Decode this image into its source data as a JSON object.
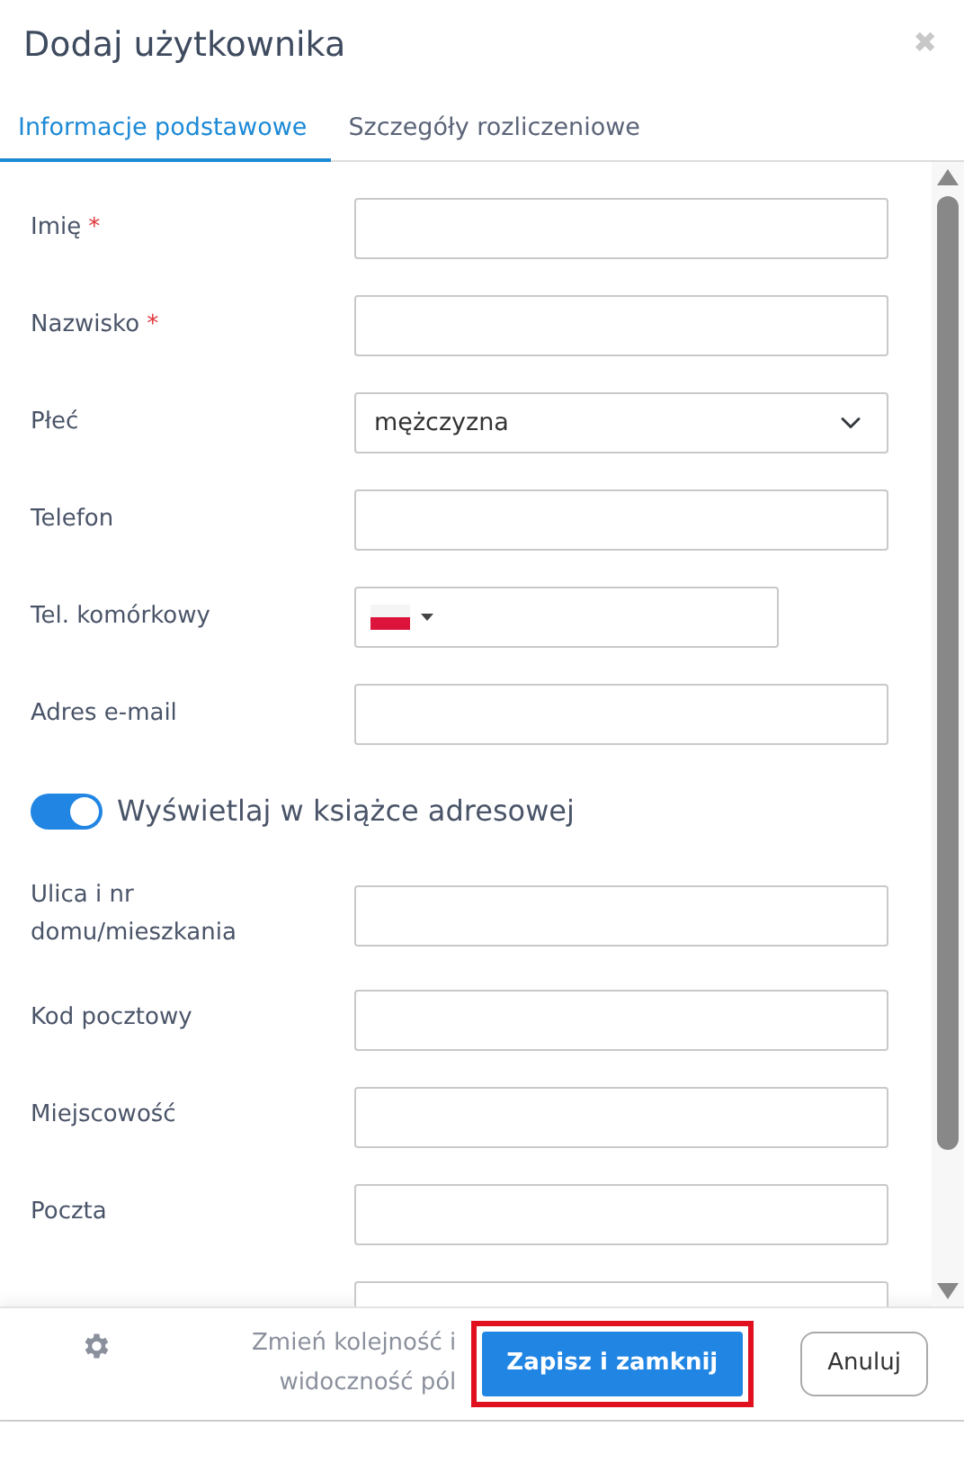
{
  "dialog": {
    "title": "Dodaj użytkownika",
    "close_icon": "✖"
  },
  "tabs": [
    {
      "label": "Informacje podstawowe",
      "selected": true
    },
    {
      "label": "Szczegóły rozliczeniowe",
      "selected": false
    }
  ],
  "fields": [
    {
      "kind": "text",
      "label": "Imię",
      "required_mark": "*"
    },
    {
      "kind": "text",
      "label": "Nazwisko",
      "required_mark": "*"
    },
    {
      "kind": "select",
      "label": "Płeć",
      "value": "mężczyzna"
    },
    {
      "kind": "text",
      "label": "Telefon"
    },
    {
      "kind": "phone",
      "label": "Tel. komórkowy"
    },
    {
      "kind": "text",
      "label": "Adres e-mail"
    },
    {
      "kind": "toggle",
      "label": "Wyświetlaj w książce adresowej",
      "on": true
    },
    {
      "kind": "text",
      "label": "Ulica i nr domu/mieszkania"
    },
    {
      "kind": "text",
      "label": "Kod pocztowy"
    },
    {
      "kind": "text",
      "label": "Miejscowość"
    },
    {
      "kind": "text",
      "label": "Poczta"
    },
    {
      "kind": "text"
    }
  ],
  "footer": {
    "settings_link": "Zmień kolejność i widoczność pól",
    "buttons": [
      {
        "kind": "primary",
        "label": "Zapisz i zamknij",
        "highlighted": true
      },
      {
        "kind": "secondary",
        "label": "Anuluj",
        "highlighted": false
      }
    ]
  }
}
